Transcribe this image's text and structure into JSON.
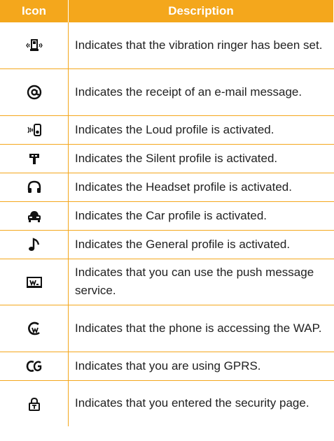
{
  "header": {
    "icon": "Icon",
    "description": "Description"
  },
  "rows": [
    {
      "icon": "vibration-icon",
      "text": "Indicates that the vibration ringer has been set."
    },
    {
      "icon": "email-at-icon",
      "text": "Indicates the receipt of an e-mail message."
    },
    {
      "icon": "loud-profile-icon",
      "text": "Indicates the Loud profile is activated."
    },
    {
      "icon": "silent-profile-icon",
      "text": "Indicates the Silent profile is activated."
    },
    {
      "icon": "headset-profile-icon",
      "text": "Indicates the Headset profile is activated."
    },
    {
      "icon": "car-profile-icon",
      "text": "Indicates the Car profile is activated."
    },
    {
      "icon": "general-profile-icon",
      "text": "Indicates the General profile is activated."
    },
    {
      "icon": "push-message-icon",
      "text": "Indicates that you can use the push message service."
    },
    {
      "icon": "wap-icon",
      "text": "Indicates that the phone is accessing the WAP."
    },
    {
      "icon": "gprs-icon",
      "text": "Indicates that you are using GPRS."
    },
    {
      "icon": "security-lock-icon",
      "text": "Indicates that you entered the security page."
    }
  ],
  "colors": {
    "accent": "#f4a71c",
    "text": "#222222"
  }
}
